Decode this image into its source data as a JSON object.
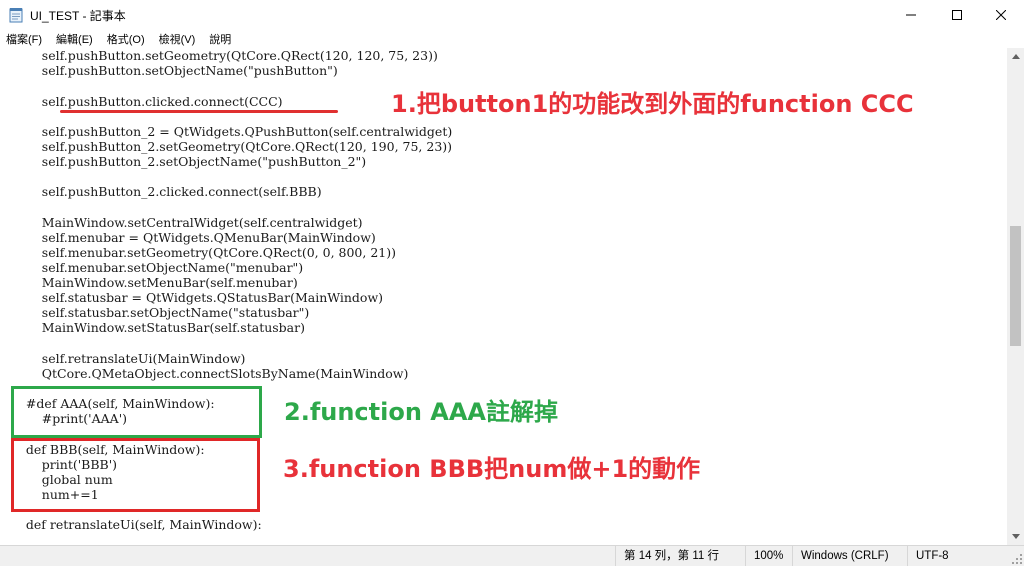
{
  "window": {
    "title": "UI_TEST - 記事本"
  },
  "menu": [
    "檔案(F)",
    "編輯(E)",
    "格式(O)",
    "檢視(V)",
    "說明"
  ],
  "editor": {
    "lines": [
      "        self.pushButton.setGeometry(QtCore.QRect(120, 120, 75, 23))",
      "        self.pushButton.setObjectName(\"pushButton\")",
      "",
      "        self.pushButton.clicked.connect(CCC)",
      "",
      "        self.pushButton_2 = QtWidgets.QPushButton(self.centralwidget)",
      "        self.pushButton_2.setGeometry(QtCore.QRect(120, 190, 75, 23))",
      "        self.pushButton_2.setObjectName(\"pushButton_2\")",
      "",
      "        self.pushButton_2.clicked.connect(self.BBB)",
      "",
      "        MainWindow.setCentralWidget(self.centralwidget)",
      "        self.menubar = QtWidgets.QMenuBar(MainWindow)",
      "        self.menubar.setGeometry(QtCore.QRect(0, 0, 800, 21))",
      "        self.menubar.setObjectName(\"menubar\")",
      "        MainWindow.setMenuBar(self.menubar)",
      "        self.statusbar = QtWidgets.QStatusBar(MainWindow)",
      "        self.statusbar.setObjectName(\"statusbar\")",
      "        MainWindow.setStatusBar(self.statusbar)",
      "",
      "        self.retranslateUi(MainWindow)",
      "        QtCore.QMetaObject.connectSlotsByName(MainWindow)",
      "",
      "    #def AAA(self, MainWindow):",
      "        #print('AAA')",
      "",
      "    def BBB(self, MainWindow):",
      "        print('BBB')",
      "        global num",
      "        num+=1",
      "",
      "    def retranslateUi(self, MainWindow):"
    ]
  },
  "annotations": {
    "note1": "1.把button1的功能改到外面的function  CCC",
    "note2": "2.function AAA註解掉",
    "note3": "3.function BBB把num做+1的動作",
    "red": "#e8323a",
    "green": "#2da84a"
  },
  "status": {
    "position": "第 14 列，第 11 行",
    "zoom": "100%",
    "line_ending": "Windows (CRLF)",
    "encoding": "UTF-8"
  },
  "icons": {
    "app": "notepad-icon",
    "minimize": "minimize-icon",
    "maximize": "maximize-icon",
    "close": "close-icon"
  }
}
